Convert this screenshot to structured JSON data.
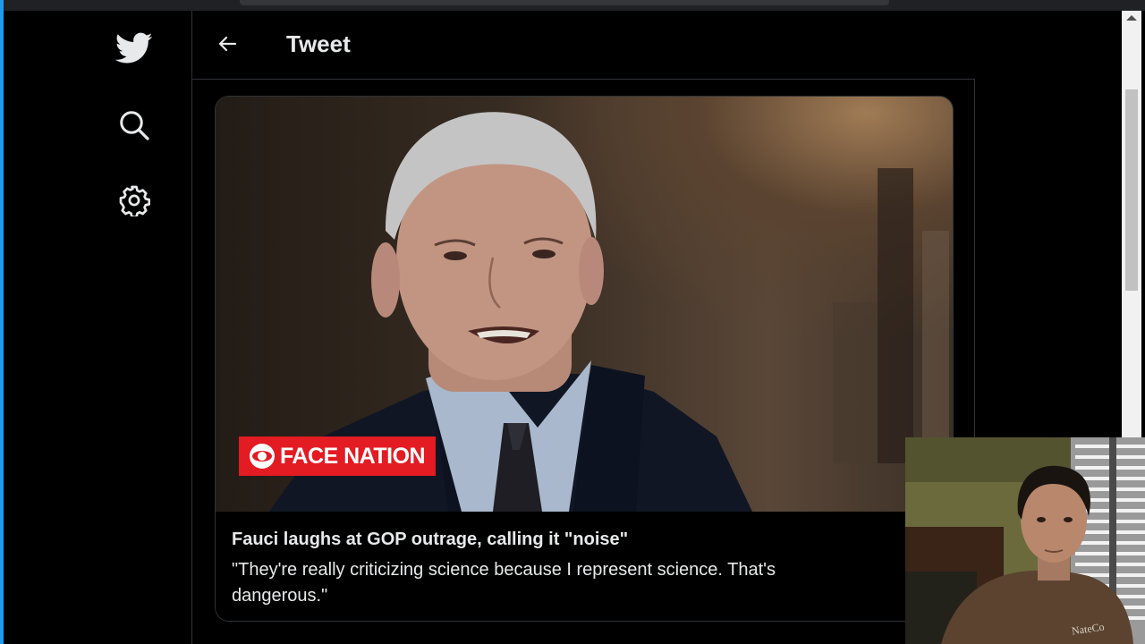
{
  "header": {
    "title": "Tweet"
  },
  "card": {
    "video_logo": "FACE NATION",
    "title": "Fauci laughs at GOP outrage, calling it \"noise\"",
    "description": "\"They're really criticizing science because I represent science. That's dangerous.\""
  },
  "webcam": {
    "shirt_text": "NateCo"
  },
  "colors": {
    "accent": "#1d9bf0",
    "background": "#000000",
    "text": "#e7e9ea",
    "logo_red": "#e31b23"
  },
  "icons": [
    "twitter-bird-icon",
    "search-icon",
    "gear-icon",
    "arrow-left-icon"
  ]
}
